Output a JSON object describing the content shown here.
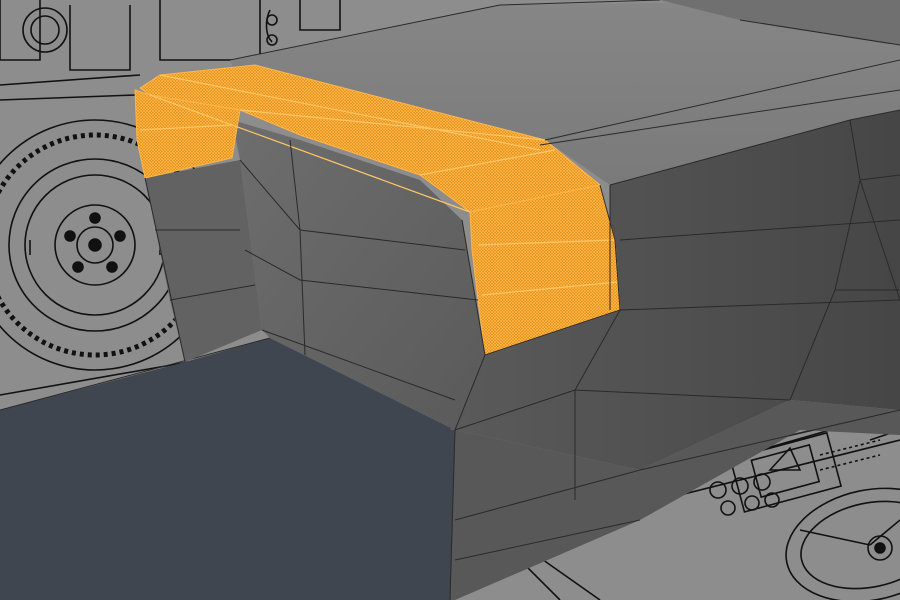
{
  "viewport": {
    "name": "3d-viewport",
    "background_color": "#8d8d8d"
  },
  "reference_blueprint": {
    "line_color": "#111111",
    "paper_color": "#8f8f8f",
    "visible_parts": [
      "spare-wheel",
      "headlight",
      "dashboard",
      "steering-wheel",
      "floor-panels"
    ]
  },
  "mesh": {
    "body_color_light": "#7a7a7a",
    "body_color_mid": "#656565",
    "body_color_dark": "#4d4d4d",
    "floor_color": "#3f4650",
    "wire_color": "#2a2a2a"
  },
  "selection": {
    "color": "#f29a1f",
    "edge_color": "#ffb54a",
    "mode": "face",
    "selected_part": "fender-top-arch"
  }
}
